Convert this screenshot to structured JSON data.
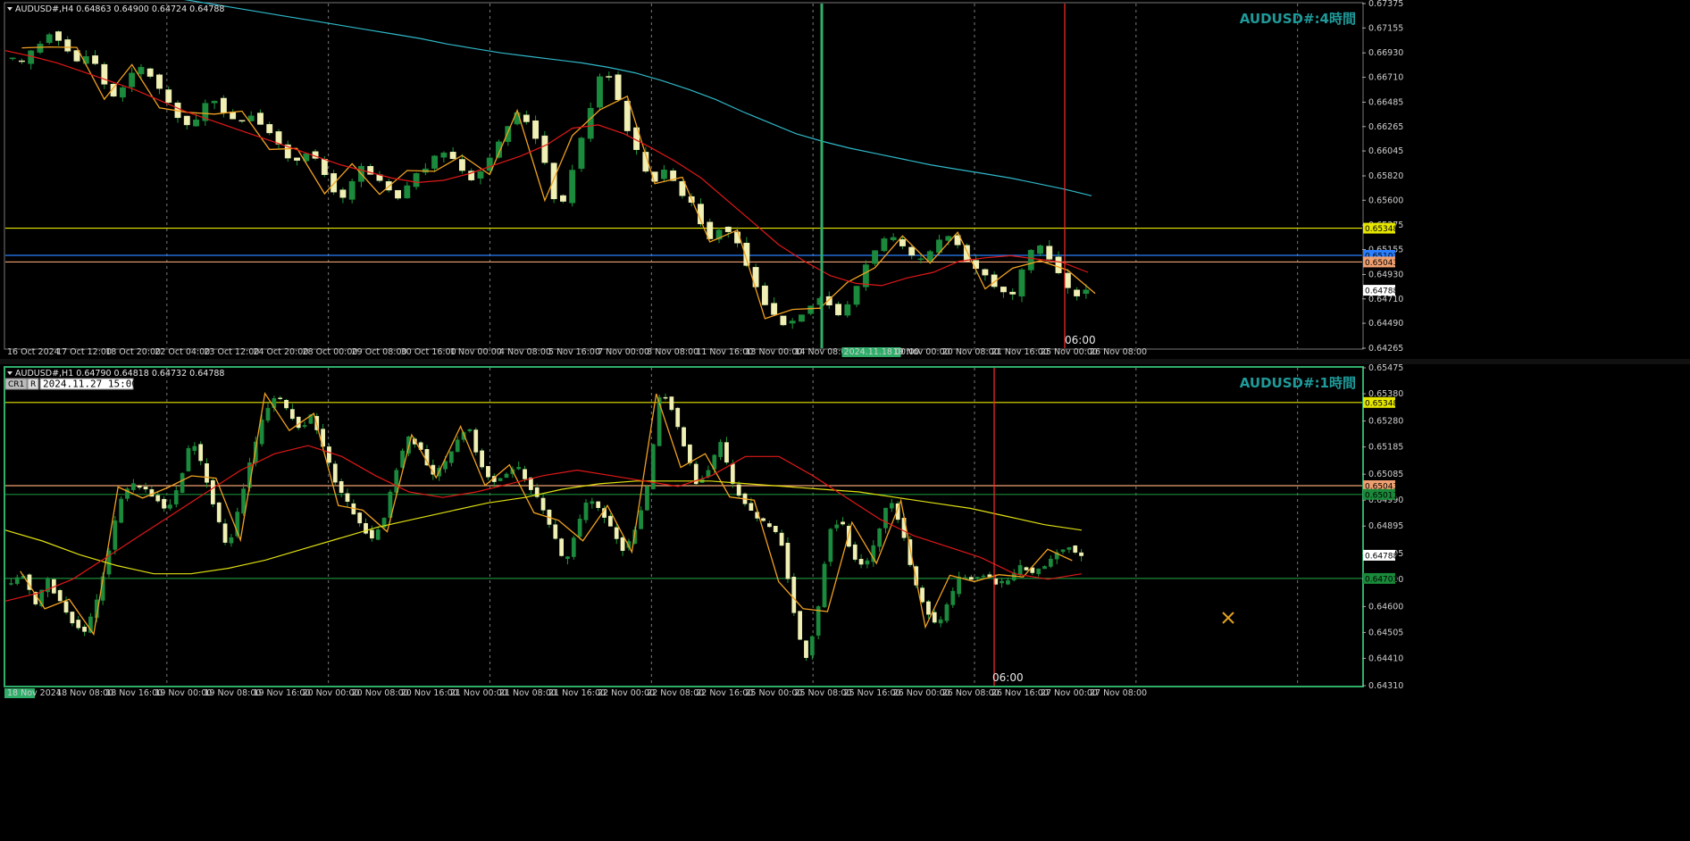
{
  "chart_data": [
    {
      "type": "candlestick",
      "symbol_header": "AUDUSD#,H4  0.64863 0.64900 0.64724 0.64788",
      "watermark": "AUDUSD#:4時間",
      "ylim": [
        0.64265,
        0.67375
      ],
      "y_ticks": [
        "0.67375",
        "0.67155",
        "0.66930",
        "0.66710",
        "0.66485",
        "0.66265",
        "0.66045",
        "0.65820",
        "0.65600",
        "0.65375",
        "0.65155",
        "0.64930",
        "0.64710",
        "0.64490",
        "0.64265"
      ],
      "x_labels": [
        "16 Oct 2024",
        "17 Oct 12:00",
        "18 Oct 20:00",
        "22 Oct 04:00",
        "23 Oct 12:00",
        "24 Oct 20:00",
        "28 Oct 00:00",
        "29 Oct 08:00",
        "30 Oct 16:00",
        "1 Nov 00:00",
        "4 Nov 08:00",
        "5 Nov 16:00",
        "7 Nov 00:00",
        "8 Nov 08:00",
        "11 Nov 16:00",
        "13 Nov 00:00",
        "14 Nov 08:00",
        "2024.11.18 00:00",
        "19 Nov 00:00",
        "20 Nov 08:00",
        "21 Nov 16:00",
        "25 Nov 00:00",
        "26 Nov 08:00"
      ],
      "current_price": "0.64788",
      "levels": [
        {
          "value": 0.65103,
          "label": "0.65103",
          "color": "#2a7fff"
        },
        {
          "value": 0.65348,
          "label": "0.65348",
          "color": "#e6e600"
        },
        {
          "value": 0.65043,
          "label": "0.65043",
          "color": "#f0a070"
        }
      ],
      "cursor_time": "06:00",
      "highlight_time": "2024.11.18 00:00",
      "close_path": [
        0.6687,
        0.6684,
        0.6695,
        0.6702,
        0.6712,
        0.6705,
        0.6693,
        0.6683,
        0.6692,
        0.668,
        0.666,
        0.6652,
        0.6665,
        0.6678,
        0.668,
        0.6668,
        0.6655,
        0.664,
        0.6633,
        0.6623,
        0.664,
        0.6655,
        0.6645,
        0.6635,
        0.6628,
        0.664,
        0.6632,
        0.6625,
        0.6612,
        0.66,
        0.6595,
        0.6605,
        0.6598,
        0.6585,
        0.657,
        0.656,
        0.6575,
        0.659,
        0.6583,
        0.6576,
        0.6568,
        0.656,
        0.6575,
        0.6585,
        0.659,
        0.66,
        0.6605,
        0.6595,
        0.6585,
        0.6578,
        0.659,
        0.6605,
        0.6615,
        0.6635,
        0.664,
        0.6625,
        0.661,
        0.658,
        0.6545,
        0.6575,
        0.6605,
        0.663,
        0.6668,
        0.668,
        0.666,
        0.663,
        0.661,
        0.659,
        0.6575,
        0.659,
        0.658,
        0.6565,
        0.656,
        0.654,
        0.6525,
        0.6535,
        0.653,
        0.652,
        0.65,
        0.648,
        0.6465,
        0.6455,
        0.6448,
        0.6452,
        0.646,
        0.6468,
        0.6475,
        0.6462,
        0.6455,
        0.647,
        0.649,
        0.651,
        0.652,
        0.6528,
        0.6522,
        0.6512,
        0.6505,
        0.6508,
        0.6518,
        0.653,
        0.6525,
        0.651,
        0.65,
        0.6495,
        0.6485,
        0.6478,
        0.647,
        0.6492,
        0.6512,
        0.652,
        0.651,
        0.6495,
        0.648,
        0.6475,
        0.6479
      ],
      "ma_red": [
        0.6695,
        0.669,
        0.6684,
        0.6676,
        0.6668,
        0.666,
        0.665,
        0.664,
        0.6632,
        0.6624,
        0.6616,
        0.6608,
        0.66,
        0.6592,
        0.6586,
        0.658,
        0.6576,
        0.6578,
        0.6584,
        0.6592,
        0.66,
        0.661,
        0.6625,
        0.6628,
        0.662,
        0.6608,
        0.6595,
        0.658,
        0.656,
        0.654,
        0.652,
        0.6505,
        0.6492,
        0.6485,
        0.6483,
        0.649,
        0.6495,
        0.6505,
        0.6508,
        0.651,
        0.6507,
        0.6504,
        0.6495
      ],
      "ma_cyan": [
        0.6742,
        0.6738,
        0.6734,
        0.673,
        0.6726,
        0.6722,
        0.6718,
        0.6714,
        0.671,
        0.6706,
        0.6701,
        0.6697,
        0.6693,
        0.669,
        0.6687,
        0.6684,
        0.668,
        0.6675,
        0.6668,
        0.666,
        0.6651,
        0.664,
        0.663,
        0.662,
        0.6613,
        0.6607,
        0.6602,
        0.6597,
        0.6592,
        0.6588,
        0.6584,
        0.658,
        0.6575,
        0.657,
        0.6564
      ],
      "gold_zigzag_count": 47,
      "candle_count": 118
    },
    {
      "type": "candlestick",
      "symbol_header": "AUDUSD#,H1  0.64790 0.64818 0.64732 0.64788",
      "watermark": "AUDUSD#:1時間",
      "ylim": [
        0.6431,
        0.65475
      ],
      "y_ticks": [
        "0.65475",
        "0.65380",
        "0.65280",
        "0.65185",
        "0.65085",
        "0.64990",
        "0.64895",
        "0.64795",
        "0.64700",
        "0.64600",
        "0.64505",
        "0.64410",
        "0.64310"
      ],
      "x_labels": [
        "18 Nov 2024",
        "18 Nov 08:00",
        "18 Nov 16:00",
        "19 Nov 00:00",
        "19 Nov 08:00",
        "19 Nov 16:00",
        "20 Nov 00:00",
        "20 Nov 08:00",
        "20 Nov 16:00",
        "21 Nov 00:00",
        "21 Nov 08:00",
        "21 Nov 16:00",
        "22 Nov 00:00",
        "22 Nov 08:00",
        "22 Nov 16:00",
        "25 Nov 00:00",
        "25 Nov 08:00",
        "25 Nov 16:00",
        "26 Nov 00:00",
        "26 Nov 08:00",
        "26 Nov 16:00",
        "27 Nov 00:00",
        "27 Nov 08:00"
      ],
      "current_price": "0.64788",
      "levels": [
        {
          "value": 0.65348,
          "label": "0.65348",
          "color": "#e6e600"
        },
        {
          "value": 0.65043,
          "label": "0.65043",
          "color": "#f0a070"
        },
        {
          "value": 0.65011,
          "label": "0.65011",
          "color": "#1a8a3a"
        },
        {
          "value": 0.64703,
          "label": "0.64703",
          "color": "#1a8a3a"
        }
      ],
      "cursor_time": "06:00",
      "crosshair_box": {
        "button1": "CR1",
        "button2": "R",
        "time": "2024.11.27 15:00"
      },
      "close_path": [
        0.6468,
        0.6472,
        0.646,
        0.647,
        0.6462,
        0.6455,
        0.645,
        0.646,
        0.6478,
        0.6498,
        0.6505,
        0.6503,
        0.65,
        0.6495,
        0.6505,
        0.6522,
        0.651,
        0.6495,
        0.648,
        0.6498,
        0.6515,
        0.653,
        0.6538,
        0.6532,
        0.6525,
        0.653,
        0.6518,
        0.6505,
        0.6498,
        0.649,
        0.6485,
        0.6492,
        0.651,
        0.6522,
        0.6518,
        0.6508,
        0.6512,
        0.652,
        0.6527,
        0.6512,
        0.6505,
        0.6508,
        0.6512,
        0.6505,
        0.6498,
        0.6488,
        0.6475,
        0.6488,
        0.65,
        0.6495,
        0.6488,
        0.648,
        0.649,
        0.6505,
        0.654,
        0.6532,
        0.6518,
        0.6505,
        0.651,
        0.652,
        0.6505,
        0.6498,
        0.6492,
        0.649,
        0.6485,
        0.646,
        0.644,
        0.6455,
        0.6488,
        0.6492,
        0.6478,
        0.6475,
        0.6485,
        0.65,
        0.649,
        0.647,
        0.646,
        0.6452,
        0.6462,
        0.6472,
        0.647,
        0.6472,
        0.6468,
        0.647,
        0.6475,
        0.6472,
        0.6475,
        0.648,
        0.6482,
        0.6478
      ],
      "ma_red": [
        0.6462,
        0.6465,
        0.647,
        0.6478,
        0.6486,
        0.6494,
        0.6502,
        0.651,
        0.6516,
        0.6519,
        0.6515,
        0.6508,
        0.6502,
        0.65,
        0.6502,
        0.6505,
        0.6508,
        0.651,
        0.6508,
        0.6506,
        0.6504,
        0.6508,
        0.6515,
        0.6515,
        0.6508,
        0.65,
        0.6492,
        0.6486,
        0.6482,
        0.6478,
        0.6472,
        0.647,
        0.6472
      ],
      "ma_yellow": [
        0.6488,
        0.6484,
        0.6479,
        0.6475,
        0.6472,
        0.6472,
        0.6474,
        0.6477,
        0.6481,
        0.6485,
        0.6489,
        0.6492,
        0.6495,
        0.6498,
        0.65,
        0.6503,
        0.6505,
        0.6506,
        0.6506,
        0.6506,
        0.6505,
        0.6504,
        0.6503,
        0.6502,
        0.65,
        0.6498,
        0.6496,
        0.6493,
        0.649,
        0.6488
      ],
      "candle_count": 176
    }
  ],
  "colors": {
    "background": "#000000",
    "bull": "#1b8a3d",
    "bear": "#f0f0b4",
    "wick": "#1f9a3a",
    "zigzag": "#f0a020",
    "ma_red": "#e01818",
    "ma_cyan": "#2fb8c8",
    "ma_yellow": "#e0e010",
    "grid": "#9a9a9a",
    "axis_text": "#cfcfcf",
    "watermark": "#1f9a9a",
    "cursor_line": "#ff2a2a",
    "highlight_line": "#2fae6a"
  }
}
